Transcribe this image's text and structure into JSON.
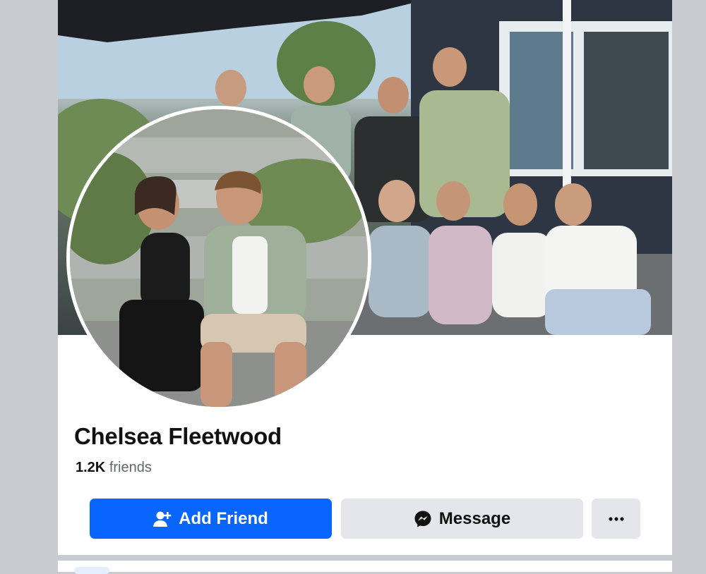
{
  "profile": {
    "name": "Chelsea Fleetwood",
    "friends_count": "1.2K",
    "friends_label": "friends"
  },
  "actions": {
    "add_friend_label": "Add Friend",
    "message_label": "Message",
    "more_icon": "more-horizontal-icon"
  },
  "colors": {
    "primary_button": "#0866ff",
    "secondary_button": "#e4e6eb",
    "page_background": "#c9cbd0"
  }
}
